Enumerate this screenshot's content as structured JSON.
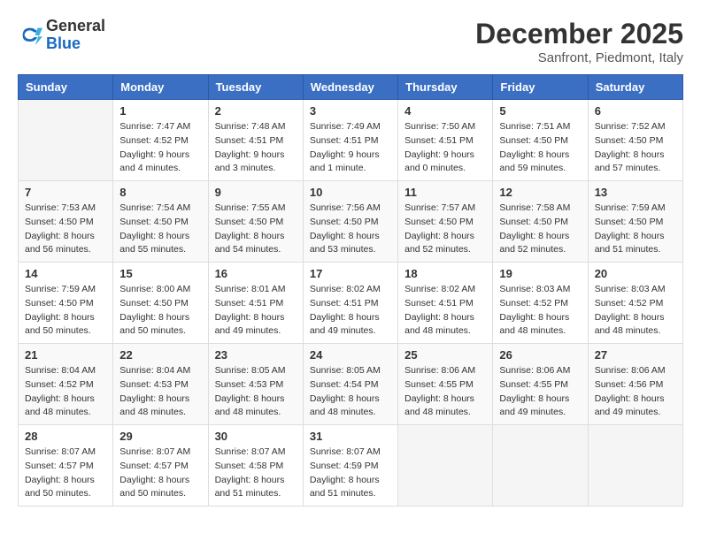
{
  "header": {
    "logo_general": "General",
    "logo_blue": "Blue",
    "month_title": "December 2025",
    "location": "Sanfront, Piedmont, Italy"
  },
  "calendar": {
    "days_of_week": [
      "Sunday",
      "Monday",
      "Tuesday",
      "Wednesday",
      "Thursday",
      "Friday",
      "Saturday"
    ],
    "weeks": [
      [
        {
          "day": "",
          "info": ""
        },
        {
          "day": "1",
          "info": "Sunrise: 7:47 AM\nSunset: 4:52 PM\nDaylight: 9 hours\nand 4 minutes."
        },
        {
          "day": "2",
          "info": "Sunrise: 7:48 AM\nSunset: 4:51 PM\nDaylight: 9 hours\nand 3 minutes."
        },
        {
          "day": "3",
          "info": "Sunrise: 7:49 AM\nSunset: 4:51 PM\nDaylight: 9 hours\nand 1 minute."
        },
        {
          "day": "4",
          "info": "Sunrise: 7:50 AM\nSunset: 4:51 PM\nDaylight: 9 hours\nand 0 minutes."
        },
        {
          "day": "5",
          "info": "Sunrise: 7:51 AM\nSunset: 4:50 PM\nDaylight: 8 hours\nand 59 minutes."
        },
        {
          "day": "6",
          "info": "Sunrise: 7:52 AM\nSunset: 4:50 PM\nDaylight: 8 hours\nand 57 minutes."
        }
      ],
      [
        {
          "day": "7",
          "info": "Sunrise: 7:53 AM\nSunset: 4:50 PM\nDaylight: 8 hours\nand 56 minutes."
        },
        {
          "day": "8",
          "info": "Sunrise: 7:54 AM\nSunset: 4:50 PM\nDaylight: 8 hours\nand 55 minutes."
        },
        {
          "day": "9",
          "info": "Sunrise: 7:55 AM\nSunset: 4:50 PM\nDaylight: 8 hours\nand 54 minutes."
        },
        {
          "day": "10",
          "info": "Sunrise: 7:56 AM\nSunset: 4:50 PM\nDaylight: 8 hours\nand 53 minutes."
        },
        {
          "day": "11",
          "info": "Sunrise: 7:57 AM\nSunset: 4:50 PM\nDaylight: 8 hours\nand 52 minutes."
        },
        {
          "day": "12",
          "info": "Sunrise: 7:58 AM\nSunset: 4:50 PM\nDaylight: 8 hours\nand 52 minutes."
        },
        {
          "day": "13",
          "info": "Sunrise: 7:59 AM\nSunset: 4:50 PM\nDaylight: 8 hours\nand 51 minutes."
        }
      ],
      [
        {
          "day": "14",
          "info": "Sunrise: 7:59 AM\nSunset: 4:50 PM\nDaylight: 8 hours\nand 50 minutes."
        },
        {
          "day": "15",
          "info": "Sunrise: 8:00 AM\nSunset: 4:50 PM\nDaylight: 8 hours\nand 50 minutes."
        },
        {
          "day": "16",
          "info": "Sunrise: 8:01 AM\nSunset: 4:51 PM\nDaylight: 8 hours\nand 49 minutes."
        },
        {
          "day": "17",
          "info": "Sunrise: 8:02 AM\nSunset: 4:51 PM\nDaylight: 8 hours\nand 49 minutes."
        },
        {
          "day": "18",
          "info": "Sunrise: 8:02 AM\nSunset: 4:51 PM\nDaylight: 8 hours\nand 48 minutes."
        },
        {
          "day": "19",
          "info": "Sunrise: 8:03 AM\nSunset: 4:52 PM\nDaylight: 8 hours\nand 48 minutes."
        },
        {
          "day": "20",
          "info": "Sunrise: 8:03 AM\nSunset: 4:52 PM\nDaylight: 8 hours\nand 48 minutes."
        }
      ],
      [
        {
          "day": "21",
          "info": "Sunrise: 8:04 AM\nSunset: 4:52 PM\nDaylight: 8 hours\nand 48 minutes."
        },
        {
          "day": "22",
          "info": "Sunrise: 8:04 AM\nSunset: 4:53 PM\nDaylight: 8 hours\nand 48 minutes."
        },
        {
          "day": "23",
          "info": "Sunrise: 8:05 AM\nSunset: 4:53 PM\nDaylight: 8 hours\nand 48 minutes."
        },
        {
          "day": "24",
          "info": "Sunrise: 8:05 AM\nSunset: 4:54 PM\nDaylight: 8 hours\nand 48 minutes."
        },
        {
          "day": "25",
          "info": "Sunrise: 8:06 AM\nSunset: 4:55 PM\nDaylight: 8 hours\nand 48 minutes."
        },
        {
          "day": "26",
          "info": "Sunrise: 8:06 AM\nSunset: 4:55 PM\nDaylight: 8 hours\nand 49 minutes."
        },
        {
          "day": "27",
          "info": "Sunrise: 8:06 AM\nSunset: 4:56 PM\nDaylight: 8 hours\nand 49 minutes."
        }
      ],
      [
        {
          "day": "28",
          "info": "Sunrise: 8:07 AM\nSunset: 4:57 PM\nDaylight: 8 hours\nand 50 minutes."
        },
        {
          "day": "29",
          "info": "Sunrise: 8:07 AM\nSunset: 4:57 PM\nDaylight: 8 hours\nand 50 minutes."
        },
        {
          "day": "30",
          "info": "Sunrise: 8:07 AM\nSunset: 4:58 PM\nDaylight: 8 hours\nand 51 minutes."
        },
        {
          "day": "31",
          "info": "Sunrise: 8:07 AM\nSunset: 4:59 PM\nDaylight: 8 hours\nand 51 minutes."
        },
        {
          "day": "",
          "info": ""
        },
        {
          "day": "",
          "info": ""
        },
        {
          "day": "",
          "info": ""
        }
      ]
    ]
  }
}
